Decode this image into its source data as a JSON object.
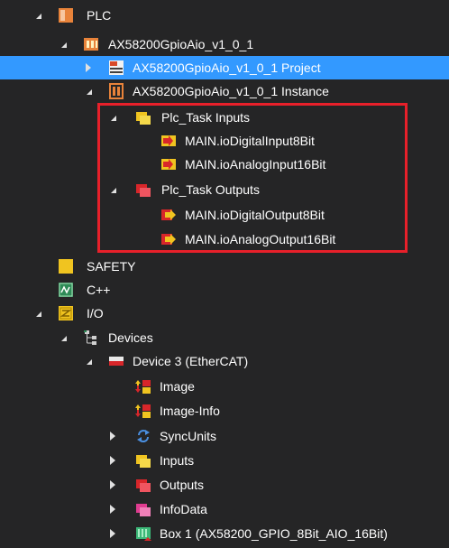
{
  "tree": {
    "plc": "PLC",
    "project_root": "AX58200GpioAio_v1_0_1",
    "project": "AX58200GpioAio_v1_0_1 Project",
    "instance": "AX58200GpioAio_v1_0_1 Instance",
    "task_inputs": "Plc_Task Inputs",
    "in_digital": "MAIN.ioDigitalInput8Bit",
    "in_analog": "MAIN.ioAnalogInput16Bit",
    "task_outputs": "Plc_Task Outputs",
    "out_digital": "MAIN.ioDigitalOutput8Bit",
    "out_analog": "MAIN.ioAnalogOutput16Bit",
    "safety": "SAFETY",
    "cpp": "C++",
    "io": "I/O",
    "devices": "Devices",
    "device3": "Device 3 (EtherCAT)",
    "image": "Image",
    "image_info": "Image-Info",
    "syncunits": "SyncUnits",
    "inputs": "Inputs",
    "outputs": "Outputs",
    "infodata": "InfoData",
    "box1": "Box 1 (AX58200_GPIO_8Bit_AIO_16Bit)"
  },
  "colors": {
    "background": "#252526",
    "selection": "#3399ff",
    "highlight_box": "#e8202a"
  }
}
